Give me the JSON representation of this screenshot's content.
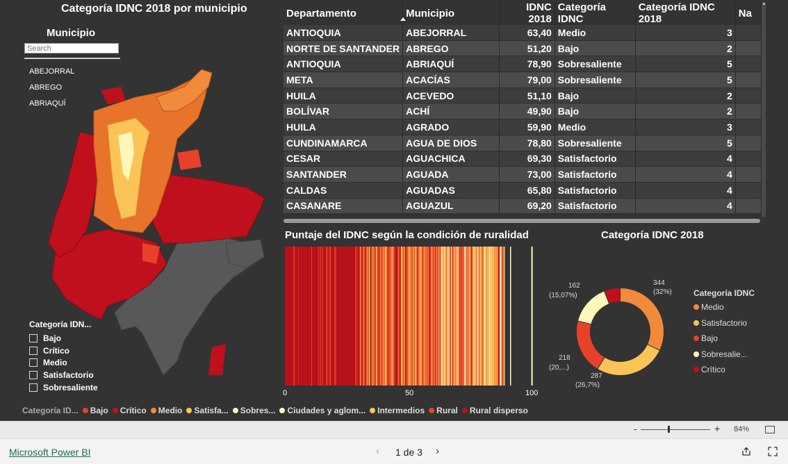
{
  "map_panel": {
    "title": "Categoría IDNC 2018 por municipio",
    "slicer_title": "Municipio",
    "search_placeholder": "Search",
    "slicer_items": [
      "ABEJORRAL",
      "ABREGO",
      "ABRIAQUÍ"
    ],
    "category_legend_title": "Categoría IDN...",
    "category_legend_items": [
      "Bajo",
      "Crítico",
      "Medio",
      "Satisfactorio",
      "Sobresaliente"
    ]
  },
  "table": {
    "columns": [
      "Departamento",
      "Municipio",
      "IDNC 2018",
      "Categoría IDNC",
      "Categoría IDNC 2018",
      "Na"
    ],
    "rows": [
      [
        "ANTIOQUIA",
        "ABEJORRAL",
        "63,40",
        "Medio",
        "3"
      ],
      [
        "NORTE DE SANTANDER",
        "ABREGO",
        "51,20",
        "Bajo",
        "2"
      ],
      [
        "ANTIOQUIA",
        "ABRIAQUÍ",
        "78,90",
        "Sobresaliente",
        "5"
      ],
      [
        "META",
        "ACACÍAS",
        "79,00",
        "Sobresaliente",
        "5"
      ],
      [
        "HUILA",
        "ACEVEDO",
        "51,10",
        "Bajo",
        "2"
      ],
      [
        "BOLÍVAR",
        "ACHÍ",
        "49,90",
        "Bajo",
        "2"
      ],
      [
        "HUILA",
        "AGRADO",
        "59,90",
        "Medio",
        "3"
      ],
      [
        "CUNDINAMARCA",
        "AGUA DE DIOS",
        "78,80",
        "Sobresaliente",
        "5"
      ],
      [
        "CESAR",
        "AGUACHICA",
        "69,30",
        "Satisfactorio",
        "4"
      ],
      [
        "SANTANDER",
        "AGUADA",
        "73,00",
        "Satisfactorio",
        "4"
      ],
      [
        "CALDAS",
        "AGUADAS",
        "65,80",
        "Satisfactorio",
        "4"
      ],
      [
        "CASANARE",
        "AGUAZUL",
        "69,20",
        "Satisfactorio",
        "4"
      ]
    ]
  },
  "rurality_chart": {
    "title": "Puntaje del IDNC según la condición de ruralidad",
    "x_ticks": [
      "0",
      "50",
      "100"
    ]
  },
  "donut_chart": {
    "title": "Categoría IDNC 2018",
    "legend_title": "Categoría IDNC",
    "legend_items": [
      "Medio",
      "Satisfactorio",
      "Bajo",
      "Sobresalie...",
      "Crítico"
    ],
    "labels": {
      "medio_count": "344",
      "medio_pct": "(32%)",
      "satisf_count": "287",
      "satisf_pct": "(26,7%)",
      "bajo_count": "218",
      "bajo_pct": "(20,...)",
      "sobre_count": "162",
      "sobre_pct": "(15,07%)"
    }
  },
  "bottom_legend": {
    "title": "Categoría ID...",
    "items": [
      "Bajo",
      "Crítico",
      "Medio",
      "Satisfa...",
      "Sobres...",
      "Ciudades y aglom...",
      "Intermedios",
      "Rural",
      "Rural disperso"
    ]
  },
  "colors": {
    "bajo": "#e8412a",
    "critico": "#c0101e",
    "medio": "#f28a3c",
    "satisfactorio": "#fbc456",
    "sobresaliente": "#fff7b8",
    "rural_disperso": "#b5121b"
  },
  "chart_data": [
    {
      "type": "pie",
      "title": "Categoría IDNC 2018",
      "categories": [
        "Medio",
        "Satisfactorio",
        "Bajo",
        "Sobresaliente",
        "Crítico"
      ],
      "values": [
        344,
        287,
        218,
        162,
        64
      ]
    },
    {
      "type": "bar",
      "title": "Puntaje del IDNC según la condición de ruralidad",
      "xlim": [
        0,
        100
      ],
      "series": [
        "Ciudades y aglomeraciones",
        "Intermedios",
        "Rural",
        "Rural disperso"
      ]
    }
  ],
  "status_bar": {
    "zoom_minus": "-",
    "zoom_plus": "+",
    "zoom_level": "84%"
  },
  "footer": {
    "brand": "Microsoft Power BI",
    "page_indicator": "1 de 3"
  }
}
